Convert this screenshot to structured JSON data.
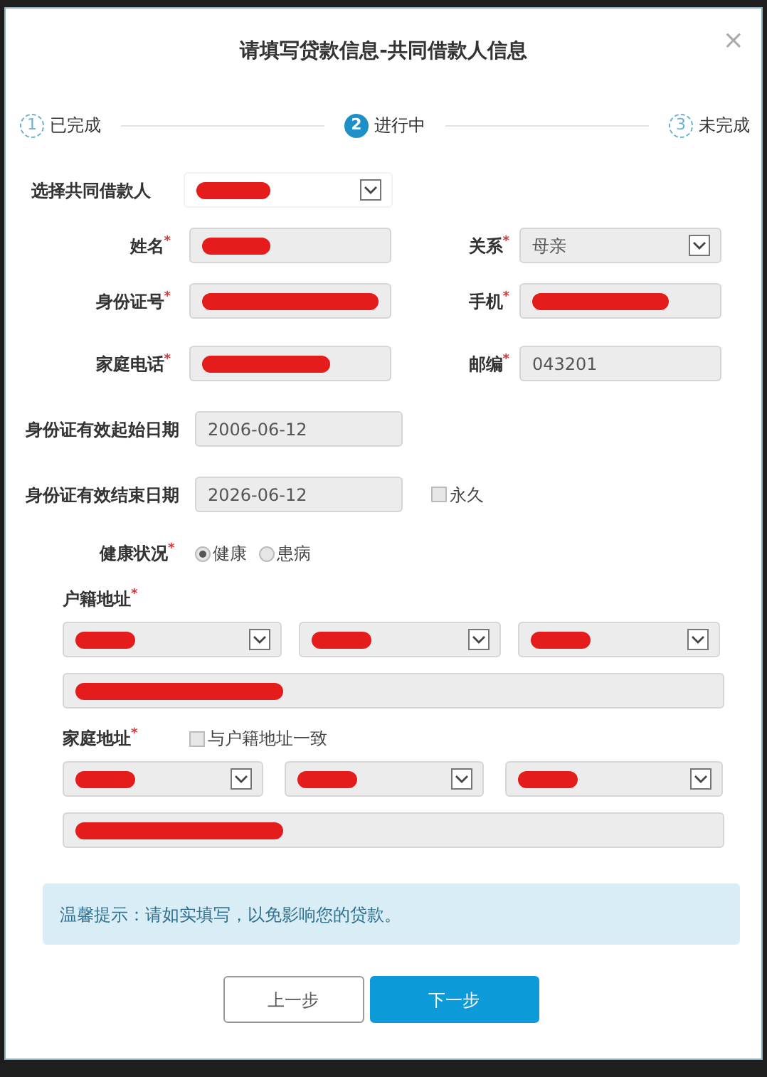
{
  "dialog": {
    "title": "请填写贷款信息-共同借款人信息",
    "close": "×"
  },
  "steps": [
    {
      "number": "1",
      "label": "已完成",
      "selected": false
    },
    {
      "number": "2",
      "label": "进行中",
      "selected": true
    },
    {
      "number": "3",
      "label": "未完成",
      "selected": false
    }
  ],
  "co_borrower": {
    "label": "选择共同借款人",
    "redacted": true
  },
  "field_rows": [
    [
      {
        "label": "姓名",
        "required_mark": "*",
        "kind": "input",
        "redacted": true
      },
      {
        "label": "关系",
        "required_mark": "*",
        "kind": "select",
        "value": "母亲"
      }
    ],
    [
      {
        "label": "身份证号",
        "required_mark": "*",
        "kind": "input",
        "redacted": true
      },
      {
        "label": "手机",
        "required_mark": "*",
        "kind": "input",
        "redacted": true
      }
    ],
    [
      {
        "label": "家庭电话",
        "required_mark": "*",
        "kind": "input",
        "redacted": true
      },
      {
        "label": "邮编",
        "required_mark": "*",
        "kind": "input",
        "value": "043201"
      }
    ]
  ],
  "dates": [
    {
      "label": "身份证有效起始日期",
      "value": "2006-06-12"
    },
    {
      "label": "身份证有效结束日期",
      "value": "2026-06-12",
      "checkbox": {
        "label": "永久",
        "checked": false
      }
    }
  ],
  "health": {
    "label": "健康状况",
    "required_mark": "*",
    "options": [
      {
        "label": "健康",
        "selected": true
      },
      {
        "label": "患病",
        "selected": false
      }
    ]
  },
  "addresses": [
    {
      "label": "户籍地址",
      "required_mark": "*",
      "selects": [
        {
          "redacted": true
        },
        {
          "redacted": true
        },
        {
          "redacted": true
        }
      ],
      "detail_redacted": true
    },
    {
      "label": "家庭地址",
      "required_mark": "*",
      "same_checkbox": {
        "label": "与户籍地址一致",
        "checked": false
      },
      "selects": [
        {
          "redacted": true
        },
        {
          "redacted": true
        },
        {
          "redacted": true
        }
      ],
      "detail_redacted": true
    }
  ],
  "notice": "温馨提示：请如实填写，以免影响您的贷款。",
  "buttons": [
    {
      "label": "上一步",
      "kind": "secondary"
    },
    {
      "label": "下一步",
      "kind": "primary"
    }
  ]
}
